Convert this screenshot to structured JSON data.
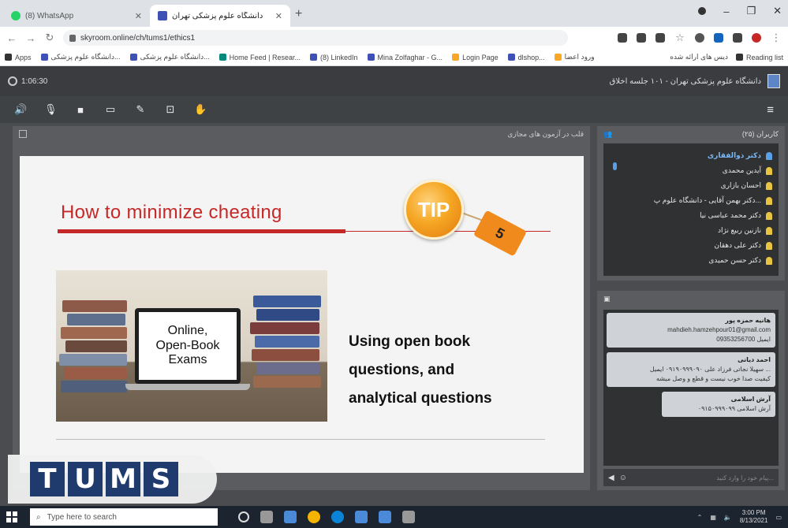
{
  "browser": {
    "tabs": [
      {
        "label": "(8) WhatsApp",
        "active": false
      },
      {
        "label": "دانشگاه علوم پزشکی تهران",
        "active": true
      }
    ],
    "address": "skyroom.online/ch/tums1/ethics1",
    "bookmarks": [
      "Apps",
      "دانشگاه علوم پزشکی...",
      "دانشگاه علوم پزشکی...",
      "Home Feed | Resear...",
      "(8) LinkedIn",
      "Mina Zolfaghar - G...",
      "Login Page",
      "dlshop...",
      "ورود اعضا"
    ],
    "bookmarks_right": [
      "دیس های ارائه شده",
      "Reading list"
    ]
  },
  "app": {
    "timer": "1:06:30",
    "room_title": "دانشگاه علوم پزشکی تهران - ۱۰۱ جلسه اخلاق",
    "content_panel_title": "قلب در آزمون های مجازی",
    "users_panel_title": "کاربران (۲۵)",
    "chat_panel_title": "گفتگو",
    "chat_placeholder": "پیام خود را وارد کنید..."
  },
  "slide": {
    "title": "How to minimize cheating",
    "tip": "TIP",
    "tip_number": "5",
    "image_caption": [
      "Online,",
      "Open-Book",
      "Exams"
    ],
    "body": [
      "Using open book",
      "questions, and",
      "analytical questions"
    ]
  },
  "users": [
    {
      "name": "دکتر ذوالفقاری",
      "me": true
    },
    {
      "name": "آیدین محمدی",
      "me": false
    },
    {
      "name": "احسان بازاری",
      "me": false
    },
    {
      "name": "دکتر بهمن آقایی - دانشگاه علوم پ...",
      "me": false
    },
    {
      "name": "دکتر محمد عباسی نیا",
      "me": false
    },
    {
      "name": "نازنین ربیع نژاد",
      "me": false
    },
    {
      "name": "دکتر علی دهقان",
      "me": false
    },
    {
      "name": "دکتر حسن حمیدی",
      "me": false
    }
  ],
  "chat": [
    {
      "who": "هانیه حمزه پور",
      "text": "mahdieh.hamzehpour01@gmail.com",
      "text2": "09353256700 ایمیل"
    },
    {
      "who": "احمد دیانی",
      "text": "سهیلا نجاتی فرزاد علی ۰۹۱۹۰۹۹۹۰۹۰ ایمیل ...",
      "text2": "کیفیت صدا خوب نیست و قطع و وصل میشه"
    },
    {
      "who": "آرش اسلامی",
      "text": "۰۹۱۵۰۹۹۹۰۹۹ آرش اسلامی",
      "text2": ""
    }
  ],
  "logo": {
    "letters": [
      "T",
      "U",
      "M",
      "S"
    ]
  },
  "taskbar": {
    "search_placeholder": "Type here to search",
    "time": "3:00 PM",
    "date": "8/13/2021"
  },
  "colors": {
    "slide_title": "#c62828",
    "tip_orange": "#f5a623",
    "logo_blue": "#1f3a6d",
    "accent_blue": "#5aa0e8"
  }
}
